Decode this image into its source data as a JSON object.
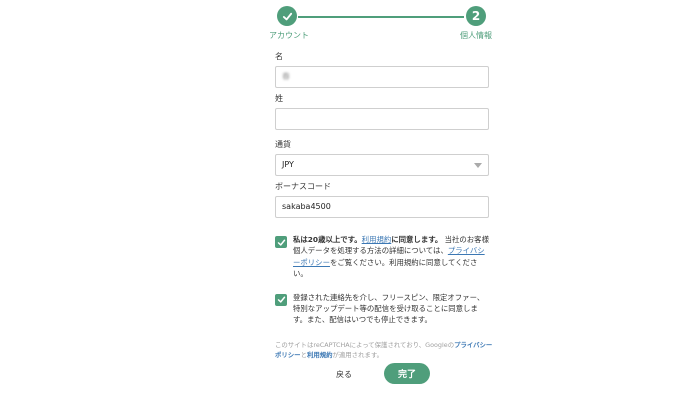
{
  "stepper": {
    "step1_label": "アカウント",
    "step2_number": "2",
    "step2_label": "個人情報"
  },
  "form": {
    "first_name": {
      "label": "名",
      "value": "春"
    },
    "last_name": {
      "label": "姓",
      "value": ""
    },
    "currency": {
      "label": "通貨",
      "value": "JPY"
    },
    "bonus_code": {
      "label": "ボーナスコード",
      "value": "sakaba4500"
    }
  },
  "consent": {
    "age_bold": "私は20歳以上です。",
    "terms_link": "利用規約",
    "age_after": "に同意します。",
    "data_text": "当社のお客様個人データを処理する方法の詳細については、",
    "privacy_link": "プライバシーポリシー",
    "data_after": "をご覧ください。利用規約に同意してください。"
  },
  "marketing": {
    "text": "登録された連絡先を介し、フリースピン、限定オファー、特別なアップデート等の配信を受け取ることに同意します。また、配信はいつでも停止できます。"
  },
  "captcha": {
    "prefix": "このサイトはreCAPTCHAによって保護されており、Googleの",
    "privacy_link": "プライバシーポリシー",
    "and": "と",
    "terms_link": "利用規約",
    "suffix": "が適用されます。"
  },
  "actions": {
    "back_label": "戻る",
    "finish_label": "完了"
  },
  "colors": {
    "accent": "#4f9e7b",
    "link": "#3c78b4"
  }
}
